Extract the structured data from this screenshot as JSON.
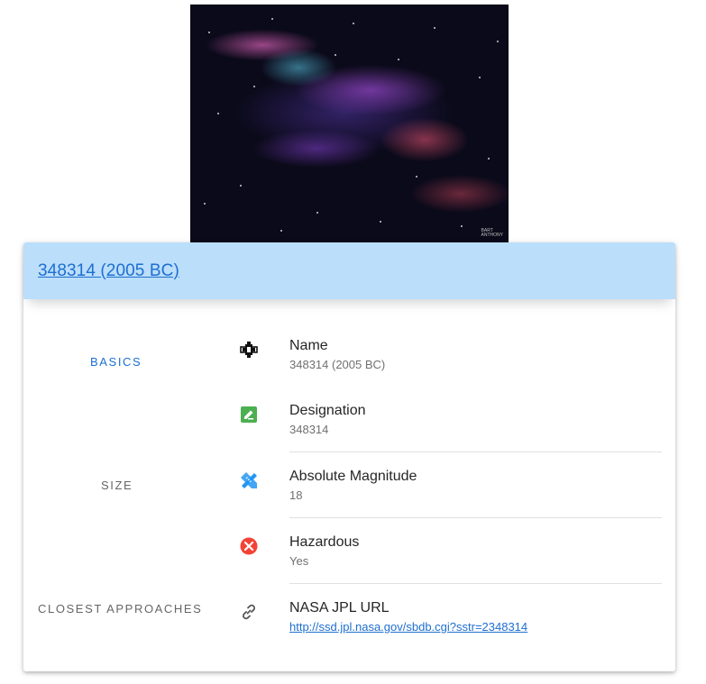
{
  "card": {
    "title": "348314 (2005 BC)"
  },
  "hero": {
    "credit_line1": "BART",
    "credit_line2": "ANTHONY"
  },
  "sections": {
    "basics": "BASICS",
    "size": "SIZE",
    "closest_approaches": "CLOSEST APPROACHES"
  },
  "rows": [
    {
      "title": "Name",
      "value": "348314 (2005 BC)",
      "icon": "satellite-icon"
    },
    {
      "title": "Designation",
      "value": "348314",
      "icon": "edit-icon"
    },
    {
      "title": "Absolute Magnitude",
      "value": "18",
      "icon": "ruler-pencil-icon"
    },
    {
      "title": "Hazardous",
      "value": "Yes",
      "icon": "close-circle-icon"
    },
    {
      "title": "NASA JPL URL",
      "value": "http://ssd.jpl.nasa.gov/sbdb.cgi?sstr=2348314",
      "icon": "link-icon"
    }
  ],
  "colors": {
    "header_bg": "#bbdefb",
    "accent": "#1e6fd0",
    "edit_green": "#4caf50",
    "ruler_blue": "#2196f3",
    "hazard_red": "#f44336"
  }
}
